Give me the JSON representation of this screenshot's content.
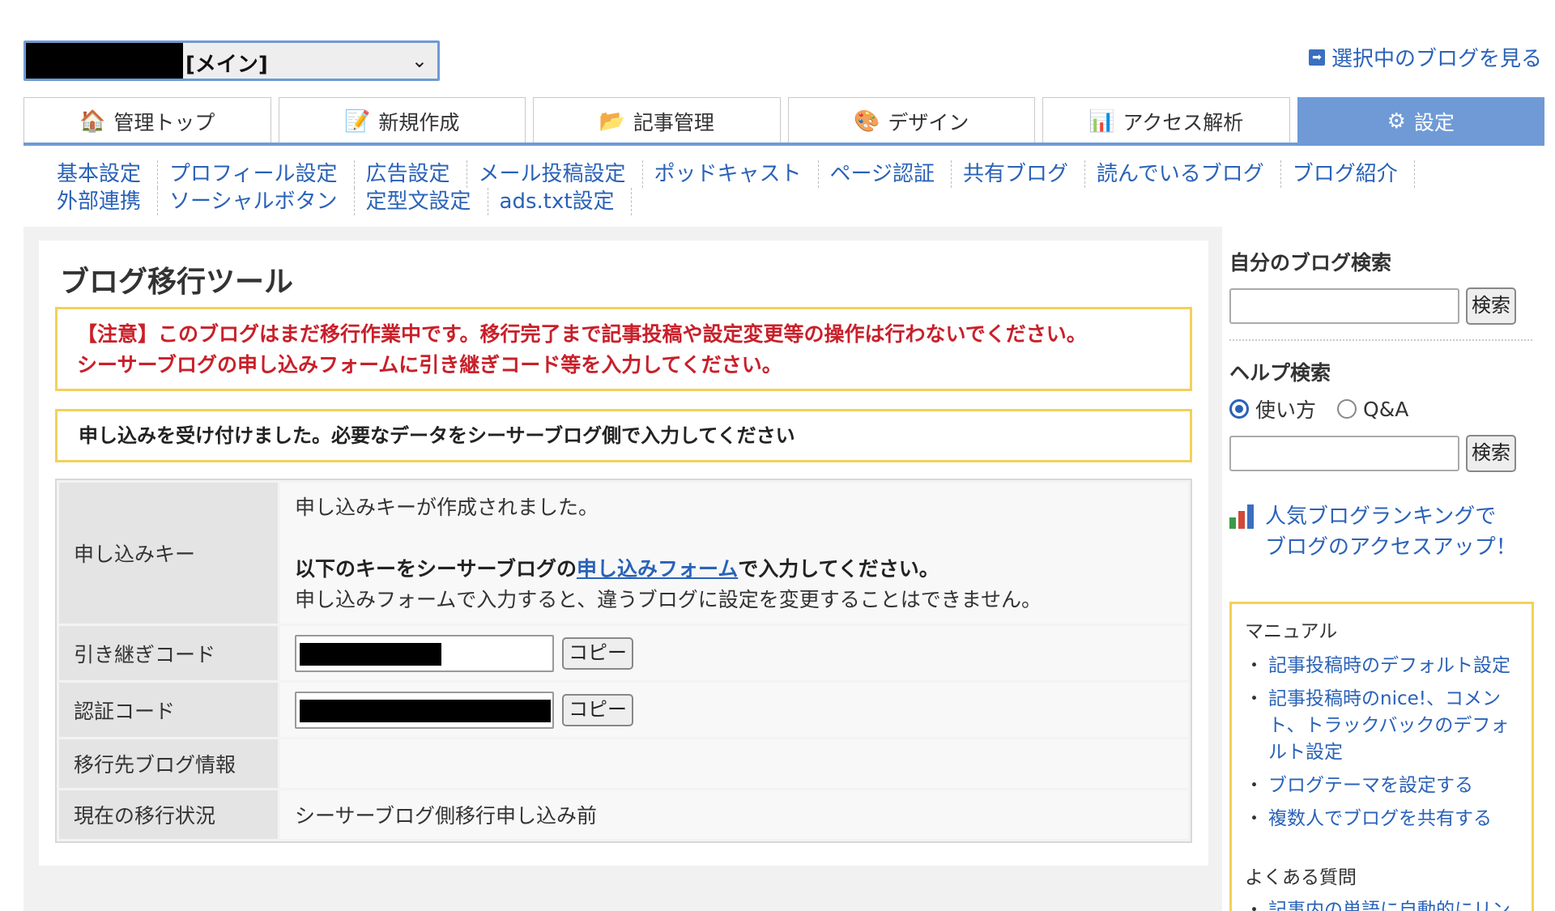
{
  "header": {
    "blog_select_label": "[メイン]",
    "blog_select_chevron": "⌄",
    "view_blog_link": "選択中のブログを見る",
    "view_blog_icon": "➡"
  },
  "tabs": [
    {
      "label": "管理トップ",
      "icon": "🏠",
      "icon_name": "home-icon"
    },
    {
      "label": "新規作成",
      "icon": "📝",
      "icon_name": "pencil-icon"
    },
    {
      "label": "記事管理",
      "icon": "📂",
      "icon_name": "folder-icon"
    },
    {
      "label": "デザイン",
      "icon": "🎨",
      "icon_name": "palette-icon"
    },
    {
      "label": "アクセス解析",
      "icon": "📊",
      "icon_name": "bar-chart-icon"
    },
    {
      "label": "設定",
      "icon": "⚙",
      "icon_name": "gear-icon",
      "active": true
    }
  ],
  "subnav": {
    "row1": [
      "基本設定",
      "プロフィール設定",
      "広告設定",
      "メール投稿設定",
      "ポッドキャスト",
      "ページ認証",
      "共有ブログ",
      "読んでいるブログ",
      "ブログ紹介"
    ],
    "row2": [
      "外部連携",
      "ソーシャルボタン",
      "定型文設定",
      "ads.txt設定"
    ]
  },
  "main": {
    "title": "ブログ移行ツール",
    "warning_line1": "【注意】このブログはまだ移行作業中です。移行完了まで記事投稿や設定変更等の操作は行わないでください。",
    "warning_line2": "シーサーブログの申し込みフォームに引き継ぎコード等を入力してください。",
    "info": "申し込みを受け付けました。必要なデータをシーサーブログ側で入力してください",
    "table": {
      "key_label": "申し込みキー",
      "key_line1": "申し込みキーが作成されました。",
      "key_line2_pre": "以下のキーをシーサーブログの",
      "key_line2_link": "申し込みフォーム",
      "key_line2_post": "で入力してください。",
      "key_line3": "申し込みフォームで入力すると、違うブログに設定を変更することはできません。",
      "handover_label": "引き継ぎコード",
      "auth_label": "認証コード",
      "copy_label": "コピー",
      "dest_label": "移行先ブログ情報",
      "dest_value": "",
      "status_label": "現在の移行状況",
      "status_value": "シーサーブログ側移行申し込み前"
    }
  },
  "sidebar": {
    "own_search_title": "自分のブログ検索",
    "search_button": "検索",
    "help_search_title": "ヘルプ検索",
    "radio_usage": "使い方",
    "radio_qa": "Q&A",
    "ranking_line1": "人気ブログランキングで",
    "ranking_line2": "ブログのアクセスアップ！",
    "manual_title": "マニュアル",
    "manual_links": [
      "記事投稿時のデフォルト設定",
      "記事投稿時のnice!、コメント、トラックバックのデフォルト設定",
      "ブログテーマを設定する",
      "複数人でブログを共有する"
    ],
    "faq_title": "よくある質問",
    "faq_partial": "記事内の単語に自動的にリン"
  },
  "colors": {
    "accent": "#6f9ad6",
    "link": "#2a62b8",
    "warning_text": "#c8202a",
    "notice_border": "#f2d15a"
  }
}
